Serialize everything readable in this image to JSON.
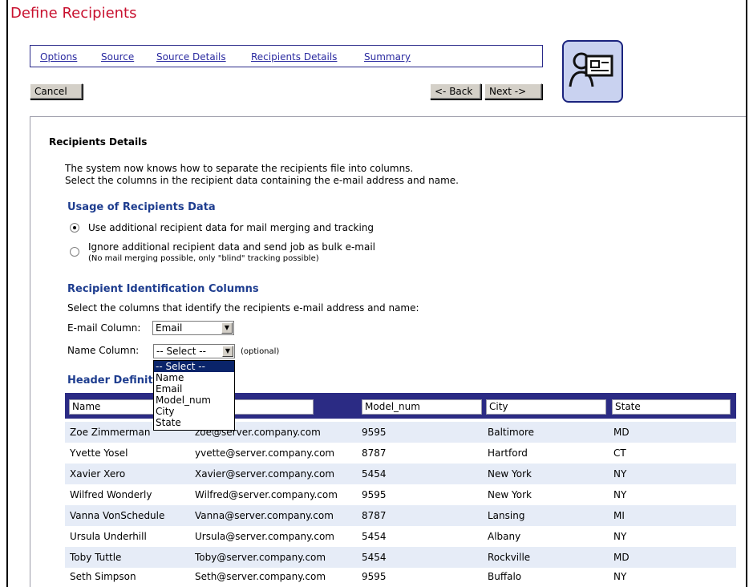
{
  "window": {
    "title": "Define Recipients"
  },
  "tabs": [
    {
      "label": "Options"
    },
    {
      "label": "Source"
    },
    {
      "label": "Source Details"
    },
    {
      "label": "Recipients Details"
    },
    {
      "label": "Summary"
    }
  ],
  "buttons": {
    "cancel": "Cancel",
    "back": "<- Back",
    "next": "Next ->"
  },
  "content": {
    "heading": "Recipients Details",
    "desc_line1": "The system now knows how to separate the recipients file into columns.",
    "desc_line2": "Select the columns in the recipient data containing the e-mail address and name.",
    "usage_section": "Usage of Recipients Data",
    "option_merge": "Use additional recipient data for mail merging and tracking",
    "option_bulk": "Ignore additional recipient data and send job as bulk e-mail",
    "option_bulk_note": "(No mail merging possible, only \"blind\" tracking possible)",
    "ident_section": "Recipient Identification Columns",
    "ident_desc": "Select the columns that identify the recipients e-mail address and name:",
    "email_col_label": "E-mail Column:",
    "email_col_value": "Email",
    "name_col_label": "Name Column:",
    "name_col_value": "-- Select --",
    "optional": "(optional)",
    "header_section": "Header Definition",
    "dropdown_options": [
      "-- Select --",
      "Name",
      "Email",
      "Model_num",
      "City",
      "State"
    ]
  },
  "table": {
    "headers": [
      "Name",
      "Email",
      "Model_num",
      "City",
      "State"
    ],
    "rows": [
      [
        "Zoe Zimmerman",
        "zoe@server.company.com",
        "9595",
        "Baltimore",
        "MD"
      ],
      [
        "Yvette Yosel",
        "yvette@server.company.com",
        "8787",
        "Hartford",
        "CT"
      ],
      [
        "Xavier Xero",
        "Xavier@server.company.com",
        "5454",
        "New York",
        "NY"
      ],
      [
        "Wilfred Wonderly",
        "Wilfred@server.company.com",
        "9595",
        "New York",
        "NY"
      ],
      [
        "Vanna VonSchedule",
        "Vanna@server.company.com",
        "8787",
        "Lansing",
        "MI"
      ],
      [
        "Ursula Underhill",
        "Ursula@server.company.com",
        "5454",
        "Albany",
        "NY"
      ],
      [
        "Toby Tuttle",
        "Toby@server.company.com",
        "5454",
        "Rockville",
        "MD"
      ],
      [
        "Seth Simpson",
        "Seth@server.company.com",
        "9595",
        "Buffalo",
        "NY"
      ]
    ]
  },
  "icons": {
    "wizard": "recipient-card-icon",
    "dropdown": "chevron-down-icon"
  },
  "colors": {
    "title": "#c8102e",
    "link": "#2a2aa0",
    "section": "#1e3d8f",
    "table_header": "#2b2b84",
    "row_alt": "#e6ecf7"
  }
}
